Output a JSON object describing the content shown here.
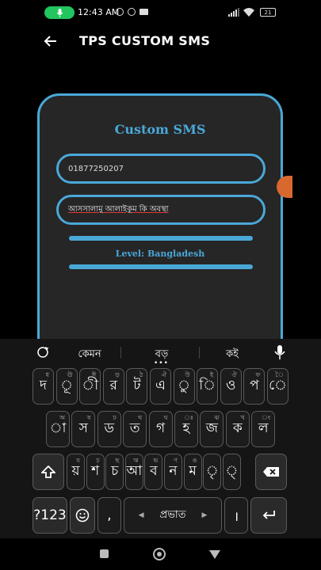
{
  "status_bar": {
    "time": "12:43 AM",
    "battery": "21"
  },
  "header": {
    "title": "TPS CUSTOM SMS"
  },
  "card": {
    "title": "Custom SMS",
    "phone_value": "01877250207",
    "message_value": "আসসালামু আলাইকুম কি অবস্থা",
    "level_text": "Level: Bangladesh"
  },
  "keyboard": {
    "suggestions": [
      "কেমন",
      "বড়",
      "কই"
    ],
    "row1": [
      {
        "k": "দ",
        "h": "ধ"
      },
      {
        "k": "ূ",
        "h": "ঊ"
      },
      {
        "k": "ী",
        "h": "ঈ"
      },
      {
        "k": "র",
        "h": "ড়"
      },
      {
        "k": "ট",
        "h": "ঠ"
      },
      {
        "k": "এ",
        "h": "ঐ"
      },
      {
        "k": "ু",
        "h": "উ"
      },
      {
        "k": "ি",
        "h": "ই"
      },
      {
        "k": "ও",
        "h": "ঔ"
      },
      {
        "k": "প",
        "h": "ফ"
      },
      {
        "k": "ে",
        "h": "ৈ"
      }
    ],
    "row2": [
      {
        "k": "া",
        "h": "অ"
      },
      {
        "k": "স",
        "h": "ষ"
      },
      {
        "k": "ড",
        "h": "ঢ"
      },
      {
        "k": "ত",
        "h": "থ"
      },
      {
        "k": "গ",
        "h": "ঘ"
      },
      {
        "k": "হ",
        "h": "ঃ"
      },
      {
        "k": "জ",
        "h": "ঝ"
      },
      {
        "k": "ক",
        "h": "খ"
      },
      {
        "k": "ল",
        "h": "ং"
      }
    ],
    "row3": [
      {
        "k": "য়",
        "h": "য"
      },
      {
        "k": "শ",
        "h": "ঢ়"
      },
      {
        "k": "চ",
        "h": "ছ"
      },
      {
        "k": "আ",
        "h": "ঋ"
      },
      {
        "k": "ব",
        "h": "ভ"
      },
      {
        "k": "ন",
        "h": "ণ"
      },
      {
        "k": "ম",
        "h": "ঙ"
      },
      {
        "k": "ৃ",
        "h": ""
      },
      {
        "k": "্",
        "h": ""
      }
    ],
    "symbols_label": "?123",
    "comma": ",",
    "space_label": "প্রভাত",
    "period": "।"
  }
}
